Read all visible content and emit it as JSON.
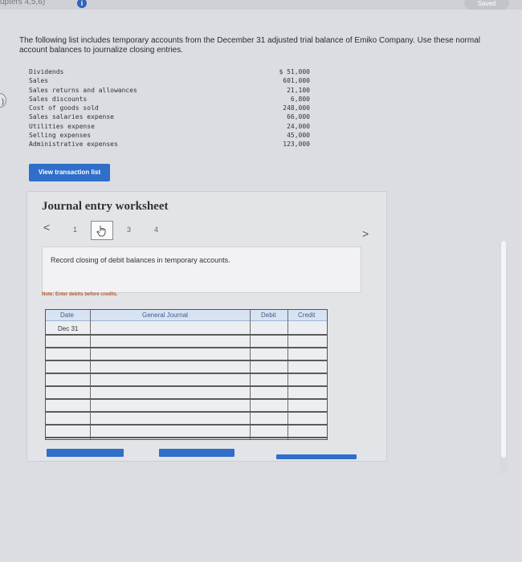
{
  "header": {
    "breadcrumb": "upters 4,5,6)",
    "info_icon": "i",
    "saved_label": "Saved"
  },
  "instructions": "The following list includes temporary accounts from the December 31 adjusted trial balance of Emiko Company. Use these normal account balances to journalize closing entries.",
  "accounts": [
    {
      "name": "Dividends",
      "amount": "$ 51,000"
    },
    {
      "name": "Sales",
      "amount": "601,000"
    },
    {
      "name": "Sales returns and allowances",
      "amount": "21,100"
    },
    {
      "name": "Sales discounts",
      "amount": "6,800"
    },
    {
      "name": "Cost of goods sold",
      "amount": "248,000"
    },
    {
      "name": "Sales salaries expense",
      "amount": "66,000"
    },
    {
      "name": "Utilities expense",
      "amount": "24,000"
    },
    {
      "name": "Selling expenses",
      "amount": "45,000"
    },
    {
      "name": "Administrative expenses",
      "amount": "123,000"
    }
  ],
  "buttons": {
    "view_transactions": "View transaction list"
  },
  "worksheet": {
    "title": "Journal entry worksheet",
    "prev_arrow": "<",
    "next_arrow": ">",
    "pages": [
      "1",
      "2",
      "3",
      "4"
    ],
    "current_page": 2,
    "description": "Record closing of debit balances in temporary accounts.",
    "note": "Note: Enter debits before credits.",
    "columns": {
      "date": "Date",
      "journal": "General Journal",
      "debit": "Debit",
      "credit": "Credit"
    },
    "first_date": "Dec 31",
    "row_count": 9
  },
  "colors": {
    "accent": "#2f6ec9",
    "note": "#b85a2a"
  },
  "icons": {
    "pointer": "hand-pointer-icon"
  }
}
